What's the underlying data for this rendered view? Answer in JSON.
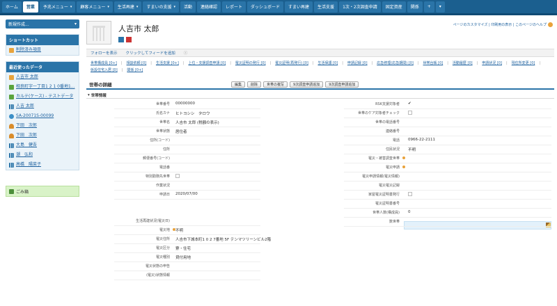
{
  "tabs": [
    {
      "label": "ホーム",
      "active": false,
      "dropdown": false
    },
    {
      "label": "営業",
      "active": true,
      "dropdown": false
    },
    {
      "label": "予兆メニュー",
      "active": false,
      "dropdown": true
    },
    {
      "label": "顧客メニュー",
      "active": false,
      "dropdown": true
    },
    {
      "label": "生活再建",
      "active": false,
      "dropdown": true
    },
    {
      "label": "すまいの支援",
      "active": false,
      "dropdown": true
    },
    {
      "label": "活動",
      "active": false,
      "dropdown": false
    },
    {
      "label": "連絡確認",
      "active": false,
      "dropdown": false
    },
    {
      "label": "レポート",
      "active": false,
      "dropdown": false
    },
    {
      "label": "ダッシュボード",
      "active": false,
      "dropdown": false
    },
    {
      "label": "すまい再建",
      "active": false,
      "dropdown": false
    },
    {
      "label": "生活支援",
      "active": false,
      "dropdown": false
    },
    {
      "label": "1次・2次調査申請",
      "active": false,
      "dropdown": false
    },
    {
      "label": "固定資産",
      "active": false,
      "dropdown": false
    },
    {
      "label": "関係",
      "active": false,
      "dropdown": false
    },
    {
      "label": "+",
      "active": false,
      "dropdown": false
    },
    {
      "label": "▾",
      "active": false,
      "dropdown": false
    }
  ],
  "sidebar": {
    "new_label": "新規作成...",
    "shortcut_header": "ショートカット",
    "shortcut_item": "削除済み項目",
    "recent_header": "最近使ったデータ",
    "recent_items": [
      {
        "icon": "document-icon",
        "label": "人吉市 太郎"
      },
      {
        "icon": "green-object-icon",
        "label": "相良町字一丁目1 2 1 0番地1..."
      },
      {
        "icon": "green-object-icon",
        "label": "カルテ(ケース) - テストデータ"
      },
      {
        "icon": "bar-chart-icon",
        "label": "人吉 太郎"
      },
      {
        "icon": "globe-icon",
        "label": "SA-20071S-00099"
      },
      {
        "icon": "person-icon",
        "label": "下田　次郎"
      },
      {
        "icon": "person-icon",
        "label": "下田　次郎"
      },
      {
        "icon": "bar-chart-icon",
        "label": "大島　健吾"
      },
      {
        "icon": "bar-chart-icon",
        "label": "潮　弘和"
      },
      {
        "icon": "bar-chart-icon",
        "label": "高橋　陽菜子"
      }
    ],
    "trash_label": "ごみ箱"
  },
  "record": {
    "name": "人吉市 太郎",
    "help_link": "ページのカスタマイズ | 印刷用の表示 | このページのヘルプ"
  },
  "feed": {
    "follow": "フォローを表示",
    "post": "クリックしてフィードを追加"
  },
  "related_links": [
    "世帯構成員 [0+]",
    "相談依頼 [0]",
    "生活支援 [0+]",
    "上位・支援調査申請 [0]",
    "罹災証明の発行 [0]",
    "罹災証明(再発行) [0]",
    "生活保護 [0]",
    "申請記録 [0]",
    "応急修理(応急期間) [0]",
    "世帯台帳 [0]",
    "活動履歴 [0]",
    "申請状況 [0]",
    "現住所変更 [0]",
    "仮設住宅入居 [0]",
    "関係 [0+]"
  ],
  "detail": {
    "title": "世帯の詳細",
    "buttons": [
      "編集",
      "削除",
      "世帯の複写",
      "9次調査申請追加",
      "9次調査申請追加"
    ],
    "section": "世帯情報"
  },
  "left_fields": [
    {
      "label": "世帯番号",
      "value": "00000000"
    },
    {
      "label": "氏名カナ",
      "value": "ヒトヨシシ　タロウ"
    },
    {
      "label": "世帯名",
      "value": "人吉市 太郎 (税額の表示)"
    },
    {
      "label": "世帯状態",
      "value": "居住者"
    },
    {
      "label": "住所(コード)",
      "value": ""
    },
    {
      "label": "住所",
      "value": ""
    },
    {
      "label": "郵便番号(コード)",
      "value": ""
    },
    {
      "label": "電話番",
      "value": ""
    },
    {
      "label": "特別勤務先世帯",
      "value": ""
    },
    {
      "label": "作業状況",
      "value": ""
    },
    {
      "label": "申請日",
      "value": "2020/07/00"
    }
  ],
  "right_fields": [
    {
      "label": "RSK支援対象者",
      "value": "✔"
    },
    {
      "label": "世帯のケア対象者チェック",
      "value": ""
    },
    {
      "label": "世帯の電話番号",
      "value": ""
    },
    {
      "label": "連絡番号",
      "value": ""
    },
    {
      "label": "電話",
      "value": "0966-22-2111"
    },
    {
      "label": "住民状況",
      "value": "不明"
    },
    {
      "label": "罹災・被害調査世帯",
      "value": ""
    },
    {
      "label": "罹災申請",
      "value": ""
    },
    {
      "label": "罹災申請情報(罹災情報)",
      "value": ""
    },
    {
      "label": "罹災罹災記録",
      "value": ""
    },
    {
      "label": "家屋罹災証明書発行",
      "value": ""
    },
    {
      "label": "罹災証明書番号",
      "value": ""
    },
    {
      "label": "世帯人数(構成員)",
      "value": "0"
    },
    {
      "label": "数世帯",
      "value": ""
    }
  ],
  "bottom_fields": [
    {
      "label": "生活再建状況(罹災日)",
      "value": ""
    },
    {
      "label": "罹災地",
      "value": "不明"
    },
    {
      "label": "罹災住所",
      "value": "人吉市下城本町1 0 2 7番地 5F テンマツリーンビル2階"
    },
    {
      "label": "罹災区分",
      "value": "寮・住宅"
    },
    {
      "label": "罹災種別",
      "value": "貸付用地"
    },
    {
      "label": "罹災状態の申告",
      "value": ""
    },
    {
      "label": "(罹災)状態情報",
      "value": ""
    }
  ]
}
